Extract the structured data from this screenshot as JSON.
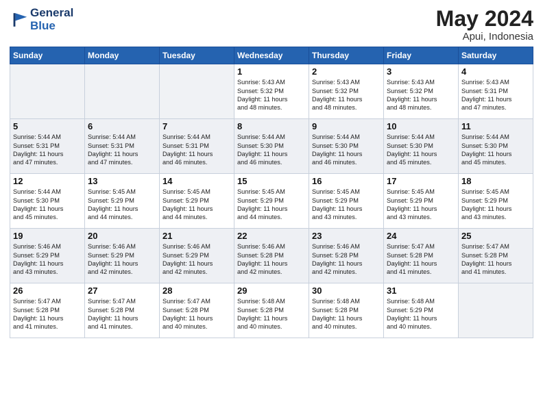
{
  "header": {
    "logo_line1": "General",
    "logo_line2": "Blue",
    "title": "May 2024",
    "subtitle": "Apui, Indonesia"
  },
  "days_of_week": [
    "Sunday",
    "Monday",
    "Tuesday",
    "Wednesday",
    "Thursday",
    "Friday",
    "Saturday"
  ],
  "weeks": [
    [
      {
        "num": "",
        "info": ""
      },
      {
        "num": "",
        "info": ""
      },
      {
        "num": "",
        "info": ""
      },
      {
        "num": "1",
        "info": "Sunrise: 5:43 AM\nSunset: 5:32 PM\nDaylight: 11 hours\nand 48 minutes."
      },
      {
        "num": "2",
        "info": "Sunrise: 5:43 AM\nSunset: 5:32 PM\nDaylight: 11 hours\nand 48 minutes."
      },
      {
        "num": "3",
        "info": "Sunrise: 5:43 AM\nSunset: 5:32 PM\nDaylight: 11 hours\nand 48 minutes."
      },
      {
        "num": "4",
        "info": "Sunrise: 5:43 AM\nSunset: 5:31 PM\nDaylight: 11 hours\nand 47 minutes."
      }
    ],
    [
      {
        "num": "5",
        "info": "Sunrise: 5:44 AM\nSunset: 5:31 PM\nDaylight: 11 hours\nand 47 minutes."
      },
      {
        "num": "6",
        "info": "Sunrise: 5:44 AM\nSunset: 5:31 PM\nDaylight: 11 hours\nand 47 minutes."
      },
      {
        "num": "7",
        "info": "Sunrise: 5:44 AM\nSunset: 5:31 PM\nDaylight: 11 hours\nand 46 minutes."
      },
      {
        "num": "8",
        "info": "Sunrise: 5:44 AM\nSunset: 5:30 PM\nDaylight: 11 hours\nand 46 minutes."
      },
      {
        "num": "9",
        "info": "Sunrise: 5:44 AM\nSunset: 5:30 PM\nDaylight: 11 hours\nand 46 minutes."
      },
      {
        "num": "10",
        "info": "Sunrise: 5:44 AM\nSunset: 5:30 PM\nDaylight: 11 hours\nand 45 minutes."
      },
      {
        "num": "11",
        "info": "Sunrise: 5:44 AM\nSunset: 5:30 PM\nDaylight: 11 hours\nand 45 minutes."
      }
    ],
    [
      {
        "num": "12",
        "info": "Sunrise: 5:44 AM\nSunset: 5:30 PM\nDaylight: 11 hours\nand 45 minutes."
      },
      {
        "num": "13",
        "info": "Sunrise: 5:45 AM\nSunset: 5:29 PM\nDaylight: 11 hours\nand 44 minutes."
      },
      {
        "num": "14",
        "info": "Sunrise: 5:45 AM\nSunset: 5:29 PM\nDaylight: 11 hours\nand 44 minutes."
      },
      {
        "num": "15",
        "info": "Sunrise: 5:45 AM\nSunset: 5:29 PM\nDaylight: 11 hours\nand 44 minutes."
      },
      {
        "num": "16",
        "info": "Sunrise: 5:45 AM\nSunset: 5:29 PM\nDaylight: 11 hours\nand 43 minutes."
      },
      {
        "num": "17",
        "info": "Sunrise: 5:45 AM\nSunset: 5:29 PM\nDaylight: 11 hours\nand 43 minutes."
      },
      {
        "num": "18",
        "info": "Sunrise: 5:45 AM\nSunset: 5:29 PM\nDaylight: 11 hours\nand 43 minutes."
      }
    ],
    [
      {
        "num": "19",
        "info": "Sunrise: 5:46 AM\nSunset: 5:29 PM\nDaylight: 11 hours\nand 43 minutes."
      },
      {
        "num": "20",
        "info": "Sunrise: 5:46 AM\nSunset: 5:29 PM\nDaylight: 11 hours\nand 42 minutes."
      },
      {
        "num": "21",
        "info": "Sunrise: 5:46 AM\nSunset: 5:29 PM\nDaylight: 11 hours\nand 42 minutes."
      },
      {
        "num": "22",
        "info": "Sunrise: 5:46 AM\nSunset: 5:28 PM\nDaylight: 11 hours\nand 42 minutes."
      },
      {
        "num": "23",
        "info": "Sunrise: 5:46 AM\nSunset: 5:28 PM\nDaylight: 11 hours\nand 42 minutes."
      },
      {
        "num": "24",
        "info": "Sunrise: 5:47 AM\nSunset: 5:28 PM\nDaylight: 11 hours\nand 41 minutes."
      },
      {
        "num": "25",
        "info": "Sunrise: 5:47 AM\nSunset: 5:28 PM\nDaylight: 11 hours\nand 41 minutes."
      }
    ],
    [
      {
        "num": "26",
        "info": "Sunrise: 5:47 AM\nSunset: 5:28 PM\nDaylight: 11 hours\nand 41 minutes."
      },
      {
        "num": "27",
        "info": "Sunrise: 5:47 AM\nSunset: 5:28 PM\nDaylight: 11 hours\nand 41 minutes."
      },
      {
        "num": "28",
        "info": "Sunrise: 5:47 AM\nSunset: 5:28 PM\nDaylight: 11 hours\nand 40 minutes."
      },
      {
        "num": "29",
        "info": "Sunrise: 5:48 AM\nSunset: 5:28 PM\nDaylight: 11 hours\nand 40 minutes."
      },
      {
        "num": "30",
        "info": "Sunrise: 5:48 AM\nSunset: 5:28 PM\nDaylight: 11 hours\nand 40 minutes."
      },
      {
        "num": "31",
        "info": "Sunrise: 5:48 AM\nSunset: 5:29 PM\nDaylight: 11 hours\nand 40 minutes."
      },
      {
        "num": "",
        "info": ""
      }
    ]
  ]
}
